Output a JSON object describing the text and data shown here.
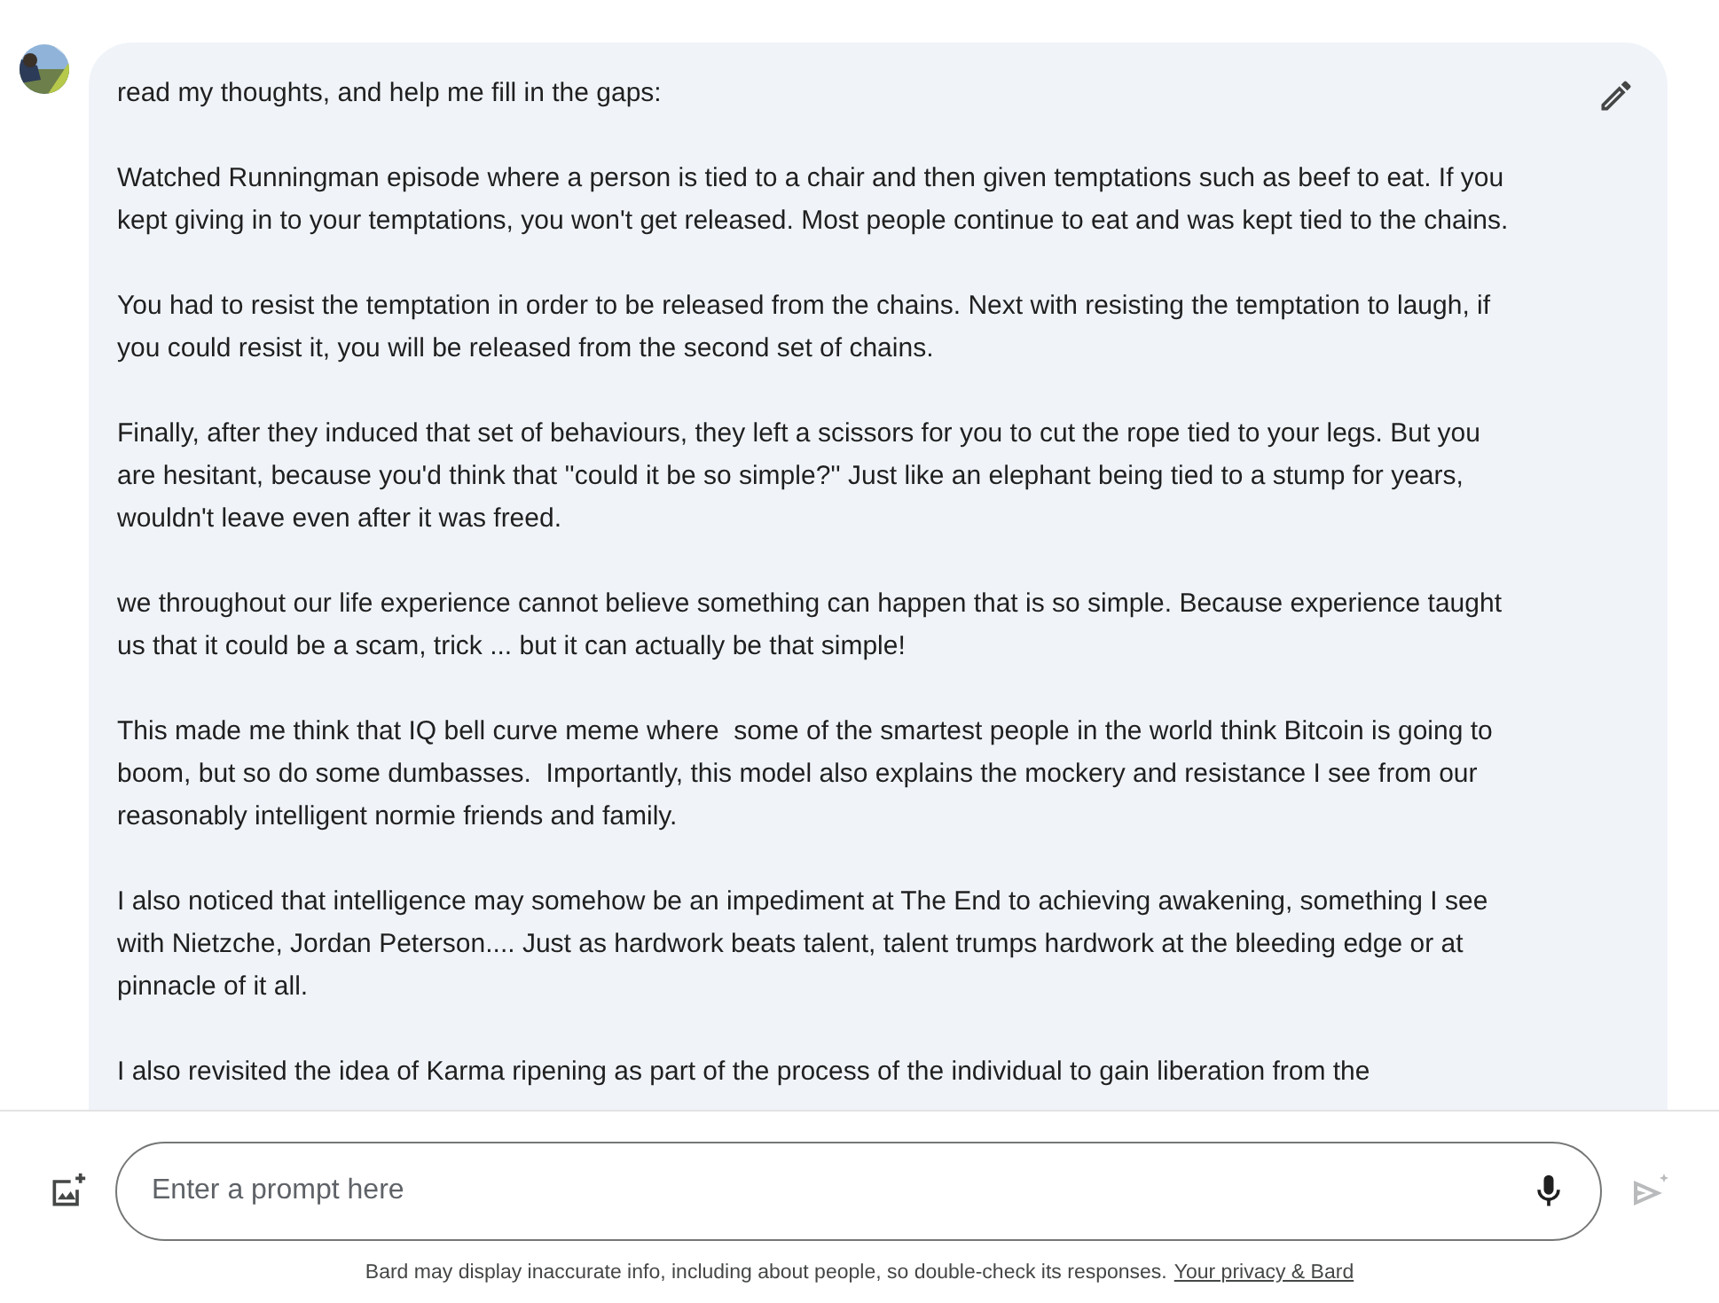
{
  "message": {
    "paragraphs": [
      "read my thoughts, and help me fill in the gaps:",
      "Watched Runningman episode where a person is tied to a chair and then given temptations such as beef to eat. If you kept giving in to your temptations, you won't get released. Most people continue to eat and was kept tied to the chains.",
      "You had to resist the temptation in order to be released from the chains. Next with resisting the temptation to laugh, if you could resist it, you will be released from the second set of chains.",
      "Finally, after they induced that set of behaviours, they left a scissors for you to cut the rope tied to your legs. But you are hesitant, because you'd think that ''could it be so simple?'' Just like an elephant being tied to a stump for years, wouldn't leave even after it was freed.",
      "we throughout our life experience cannot believe something can happen that is so simple. Because experience taught us that it could be a scam, trick ... but it can actually be that simple!",
      "This made me think that IQ bell curve meme where  some of the smartest people in the world think Bitcoin is going to boom, but so do some dumbasses.  Importantly, this model also explains the mockery and resistance I see from our reasonably intelligent normie friends and family.",
      "I also noticed that intelligence may somehow be an impediment at The End to achieving awakening, something I see with Nietzche, Jordan Peterson.... Just as hardwork beats talent, talent trumps hardwork at the bleeding edge or at pinnacle of it all.",
      "I also revisited the idea of Karma ripening as part of the process of the individual to gain liberation from the"
    ]
  },
  "prompt": {
    "placeholder": "Enter a prompt here",
    "send_disabled": true
  },
  "disclaimer": {
    "text": "Bard may display inaccurate info, including about people, so double-check its responses.",
    "link": "Your privacy & Bard"
  }
}
